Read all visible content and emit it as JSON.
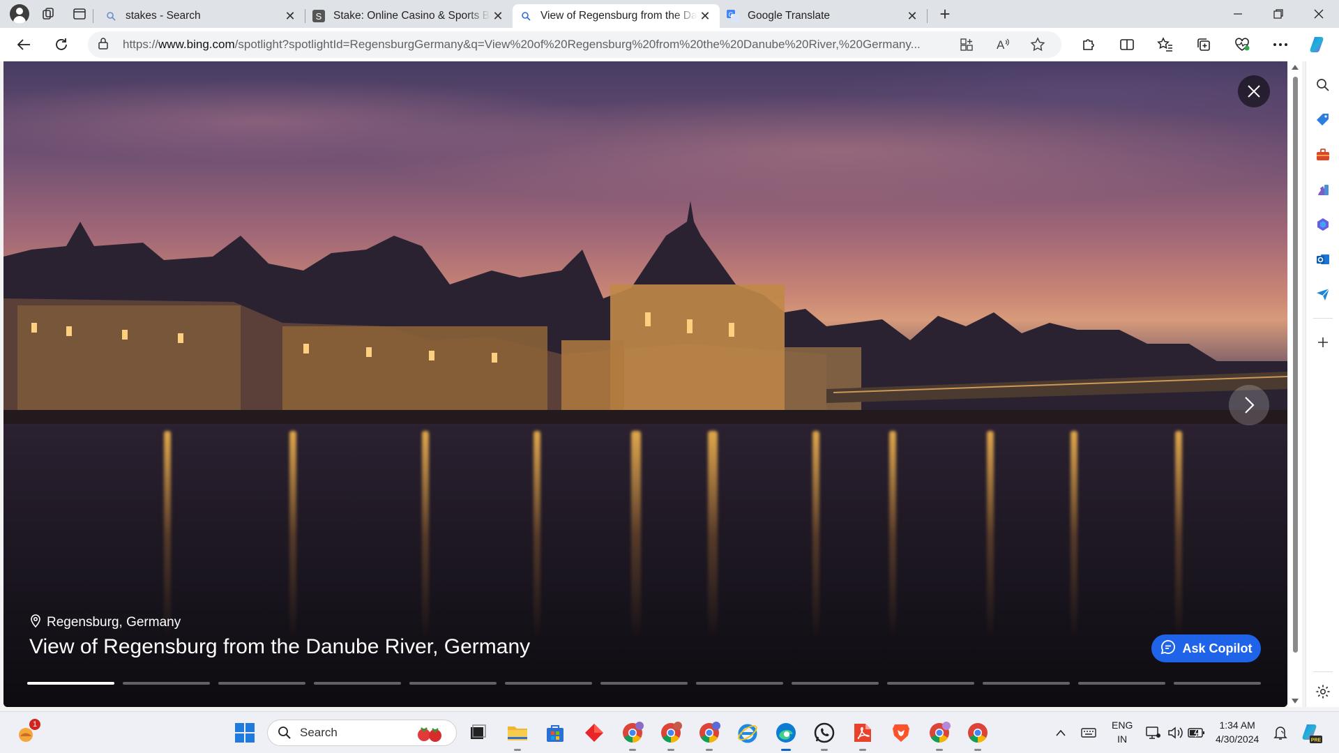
{
  "browser": {
    "tabs": [
      {
        "title": "stakes - Search",
        "favicon": "search-icon",
        "active": false
      },
      {
        "title": "Stake: Online Casino & Sports Betting",
        "favicon": "stake-logo-icon",
        "active": false
      },
      {
        "title": "View of Regensburg from the Danube River",
        "favicon": "search-icon",
        "active": true
      },
      {
        "title": "Google Translate",
        "favicon": "google-translate-icon",
        "active": false
      }
    ],
    "address": {
      "prefix": "https://",
      "host": "www.bing.com",
      "path": "/spotlight?spotlightId=RegensburgGermany&q=View%20of%20Regensburg%20from%20the%20Danube%20River,%20Germany..."
    }
  },
  "spotlight": {
    "location": "Regensburg, Germany",
    "title": "View of Regensburg from the Danube River, Germany",
    "copilot_label": "Ask Copilot",
    "progress_segments": 13,
    "active_segment": 0
  },
  "taskbar": {
    "search_label": "Search",
    "notification_count": "1",
    "language_line1": "ENG",
    "language_line2": "IN",
    "time": "1:34 AM",
    "date": "4/30/2024"
  },
  "colors": {
    "accent": "#1f64e8",
    "tabstrip": "#dfe2e6",
    "taskbar": "#eef0f5"
  }
}
